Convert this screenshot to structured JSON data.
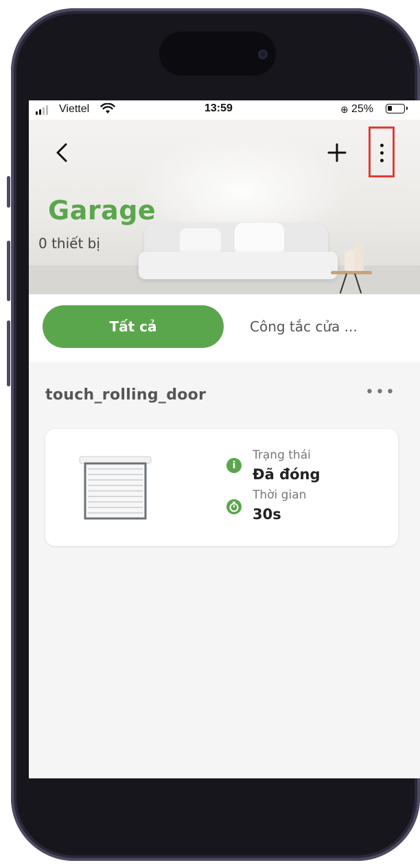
{
  "status_bar": {
    "carrier": "Viettel",
    "time": "13:59",
    "battery": "25%"
  },
  "header": {
    "back_icon": "chevron-left-icon",
    "add_icon": "plus-icon",
    "more_icon": "vertical-ellipsis-icon",
    "title": "Garage",
    "subtitle": "0 thiết bị"
  },
  "tabs": [
    {
      "label": "Tất cả",
      "active": true
    },
    {
      "label": "Công tắc cửa ...",
      "active": false
    }
  ],
  "group": {
    "name": "touch_rolling_door",
    "more_label": "•••",
    "device": {
      "icon": "rolling-door-icon",
      "status_label": "Trạng thái",
      "status_value": "Đã đóng",
      "time_label": "Thời gian",
      "time_value": "30s"
    }
  },
  "colors": {
    "accent": "#5aa64c",
    "highlight": "#e53935"
  }
}
